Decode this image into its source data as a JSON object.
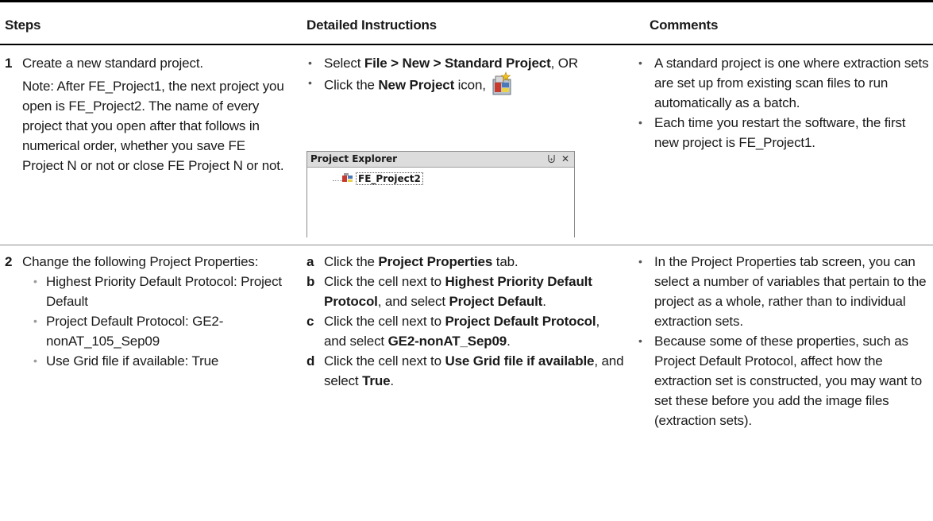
{
  "headers": {
    "steps": "Steps",
    "instructions": "Detailed Instructions",
    "comments": "Comments"
  },
  "row1": {
    "num": "1",
    "step_text": "Create a new standard project.",
    "note": "Note: After FE_Project1, the next project you open is FE_Project2. The name of every project that you open after that follows in numerical order, whether you save FE Project N or not or close FE Project N or not.",
    "instr1_pre": "Select ",
    "instr1_bold": "File > New > Standard Project",
    "instr1_post": ", OR",
    "instr2_pre": "Click the ",
    "instr2_bold": "New Project",
    "instr2_post": " icon,",
    "panel_title": "Project Explorer",
    "panel_pin": "Ѱ",
    "panel_close": "×",
    "panel_item": "FE_Project2",
    "comment1": "A standard project is one where extraction sets are set up from existing scan files to run automatically as a batch.",
    "comment2": "Each time you restart the software, the first new project is FE_Project1."
  },
  "row2": {
    "num": "2",
    "step_text": "Change the following Project Properties:",
    "props": [
      "Highest Priority Default Protocol: Project Default",
      "Project Default Protocol: GE2-nonAT_105_Sep09",
      "Use Grid file if available: True"
    ],
    "a_letter": "a",
    "a_pre": "Click the ",
    "a_bold": "Project Properties",
    "a_post": " tab.",
    "b_letter": "b",
    "b_pre": "Click the cell next to ",
    "b_bold1": "Highest Priority Default Protocol",
    "b_mid": ", and select ",
    "b_bold2": "Project Default",
    "b_post": ".",
    "c_letter": "c",
    "c_pre": "Click the cell next to ",
    "c_bold1": "Project Default Protocol",
    "c_mid": ", and select ",
    "c_bold2": "GE2-nonAT_Sep09",
    "c_post": ".",
    "d_letter": "d",
    "d_pre": "Click the cell next to ",
    "d_bold1": "Use Grid file if available",
    "d_mid": ", and select ",
    "d_bold2": "True",
    "d_post": ".",
    "comment1": "In the Project Properties tab screen, you can select a number of variables that pertain to the project as a whole, rather than to individual extraction sets.",
    "comment2": "Because some of these properties, such as Project Default Protocol, affect how the extraction set is constructed, you may want to set these before you add the image files (extraction sets)."
  },
  "icons": {
    "new_project": "new-project-icon",
    "project_item": "project-tree-icon"
  }
}
